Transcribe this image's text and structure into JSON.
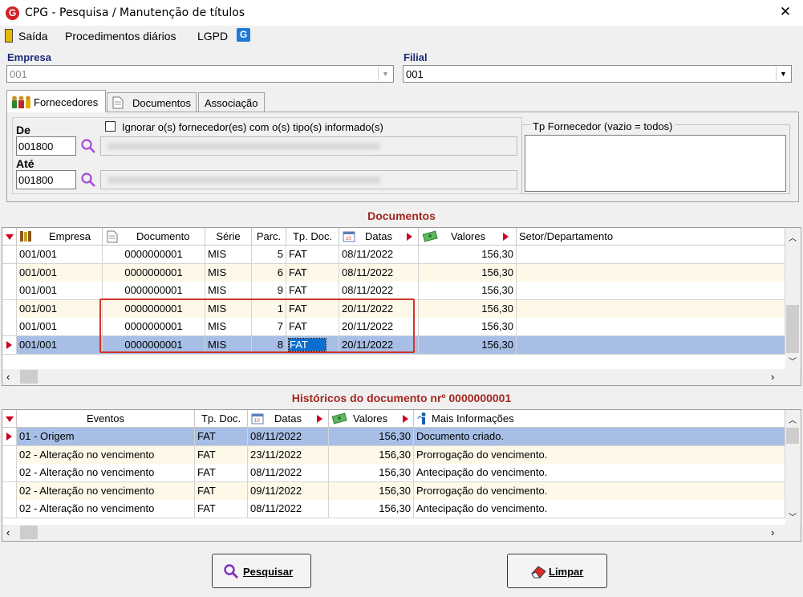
{
  "window": {
    "title": "CPG - Pesquisa / Manutenção de títulos",
    "close_glyph": "✕",
    "app_icon": "G"
  },
  "menu": {
    "items": [
      {
        "label": "Saída"
      },
      {
        "label": "Procedimentos diários"
      },
      {
        "label": "LGPD"
      }
    ],
    "lgpd_icon": "G"
  },
  "empresa": {
    "label": "Empresa",
    "value": "001"
  },
  "filial": {
    "label": "Filial",
    "value": "001"
  },
  "tabs": [
    {
      "label": "Fornecedores"
    },
    {
      "label": "Documentos"
    },
    {
      "label": "Associação"
    }
  ],
  "fornecedores": {
    "de_label": "De",
    "de_value": "001800",
    "ate_label": "Até",
    "ate_value": "001800",
    "ignore_checkbox": "Ignorar o(s) fornecedor(es) com o(s) tipo(s) informado(s)",
    "ignore_checked": false,
    "tp_label": "Tp Fornecedor (vazio = todos)"
  },
  "documentos": {
    "title": "Documentos",
    "columns": [
      "Empresa",
      "Documento",
      "Série",
      "Parc.",
      "Tp. Doc.",
      "Datas",
      "Valores",
      "Setor/Departamento"
    ],
    "rows": [
      [
        "001/001",
        "0000000001",
        "MIS",
        "5",
        "FAT",
        "08/11/2022",
        "156,30",
        ""
      ],
      [
        "001/001",
        "0000000001",
        "MIS",
        "6",
        "FAT",
        "08/11/2022",
        "156,30",
        ""
      ],
      [
        "001/001",
        "0000000001",
        "MIS",
        "9",
        "FAT",
        "08/11/2022",
        "156,30",
        ""
      ],
      [
        "001/001",
        "0000000001",
        "MIS",
        "1",
        "FAT",
        "20/11/2022",
        "156,30",
        ""
      ],
      [
        "001/001",
        "0000000001",
        "MIS",
        "7",
        "FAT",
        "20/11/2022",
        "156,30",
        ""
      ],
      [
        "001/001",
        "0000000001",
        "MIS",
        "8",
        "FAT",
        "20/11/2022",
        "156,30",
        ""
      ]
    ],
    "selected_row": 5
  },
  "historicos": {
    "title": "Históricos do documento nrº 0000000001",
    "columns": [
      "Eventos",
      "Tp. Doc.",
      "Datas",
      "Valores",
      "Mais Informações"
    ],
    "rows": [
      [
        "01 - Origem",
        "FAT",
        "08/11/2022",
        "156,30",
        "Documento criado."
      ],
      [
        "02 - Alteração no vencimento",
        "FAT",
        "23/11/2022",
        "156,30",
        "Prorrogação do vencimento."
      ],
      [
        "02 - Alteração no vencimento",
        "FAT",
        "08/11/2022",
        "156,30",
        "Antecipação do vencimento."
      ],
      [
        "02 - Alteração no vencimento",
        "FAT",
        "09/11/2022",
        "156,30",
        "Prorrogação do vencimento."
      ],
      [
        "02 - Alteração no vencimento",
        "FAT",
        "08/11/2022",
        "156,30",
        "Antecipação do vencimento."
      ]
    ],
    "selected_row": 0
  },
  "buttons": {
    "pesquisar": "Pesquisar",
    "limpar": "Limpar"
  },
  "colors": {
    "accent_red": "#a2271f",
    "label_blue": "#1a2b7a",
    "selection": "#a7bfe6",
    "row_alt": "#fdf8e8",
    "highlight_box": "#d0342c"
  }
}
